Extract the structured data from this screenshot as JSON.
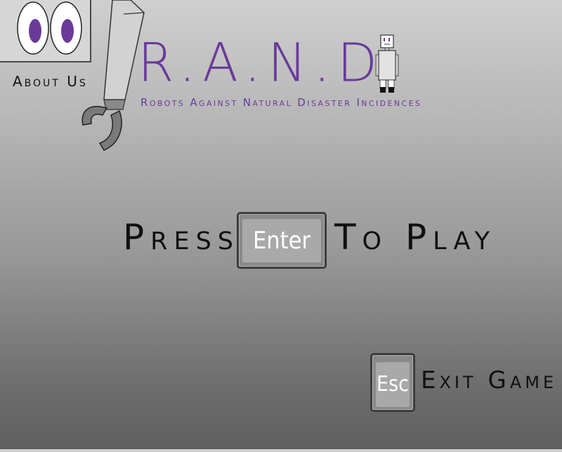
{
  "about": {
    "label": "About Us"
  },
  "title": {
    "main": "R.A.N.D.",
    "subtitle": "Robots Against Natural Disaster Incidences"
  },
  "play_prompt": {
    "before": "Press",
    "key_label": "Enter",
    "after": "To Play"
  },
  "exit_prompt": {
    "key_label": "Esc",
    "label": "Exit Game"
  },
  "colors": {
    "accent_purple": "#6a3a9a",
    "text_dark": "#111111",
    "key_face": "#a9a9a9",
    "key_border": "#3c3c3c"
  },
  "icons": {
    "about_character": "robot-head-icon",
    "arm": "robot-arm-claw-icon",
    "mascot": "small-robot-icon"
  }
}
